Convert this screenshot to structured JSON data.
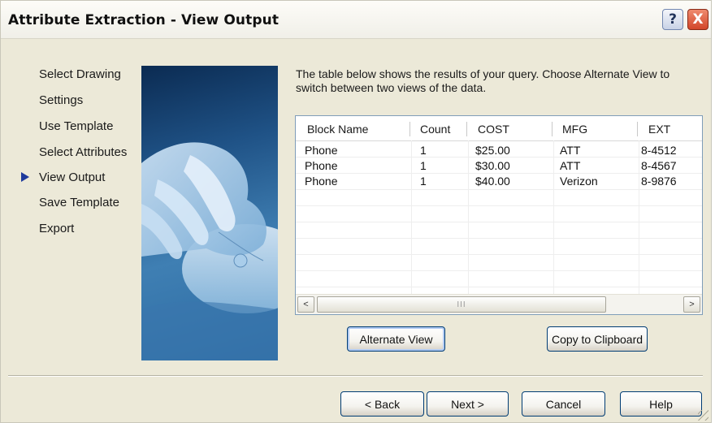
{
  "window": {
    "title": "Attribute Extraction - View Output",
    "help_button": "?",
    "close_button": "X"
  },
  "nav": {
    "items": [
      {
        "label": "Select Drawing",
        "current": false
      },
      {
        "label": "Settings",
        "current": false
      },
      {
        "label": "Use Template",
        "current": false
      },
      {
        "label": "Select Attributes",
        "current": false
      },
      {
        "label": "View Output",
        "current": true
      },
      {
        "label": "Save Template",
        "current": false
      },
      {
        "label": "Export",
        "current": false
      }
    ]
  },
  "main": {
    "description": "The table below shows the results of your query. Choose Alternate View to switch between two views of the data.",
    "table": {
      "columns": [
        "Block Name",
        "Count",
        "COST",
        "MFG",
        "EXT"
      ],
      "rows": [
        [
          "Phone",
          "1",
          "$25.00",
          "ATT",
          "8-4512"
        ],
        [
          "Phone",
          "1",
          "$30.00",
          "ATT",
          "8-4567"
        ],
        [
          "Phone",
          "1",
          "$40.00",
          "Verizon",
          "8-9876"
        ]
      ]
    },
    "scrollbar": {
      "left_arrow": "<",
      "right_arrow": ">",
      "thumb_grip": "III"
    },
    "alternate_view_label": "Alternate View",
    "copy_clipboard_label": "Copy to Clipboard"
  },
  "footer": {
    "back_label": "< Back",
    "next_label": "Next >",
    "cancel_label": "Cancel",
    "help_label": "Help"
  },
  "colors": {
    "dialog_face": "#ece9d8",
    "accent_arrow": "#1e3a9c",
    "button_border": "#003c74"
  }
}
